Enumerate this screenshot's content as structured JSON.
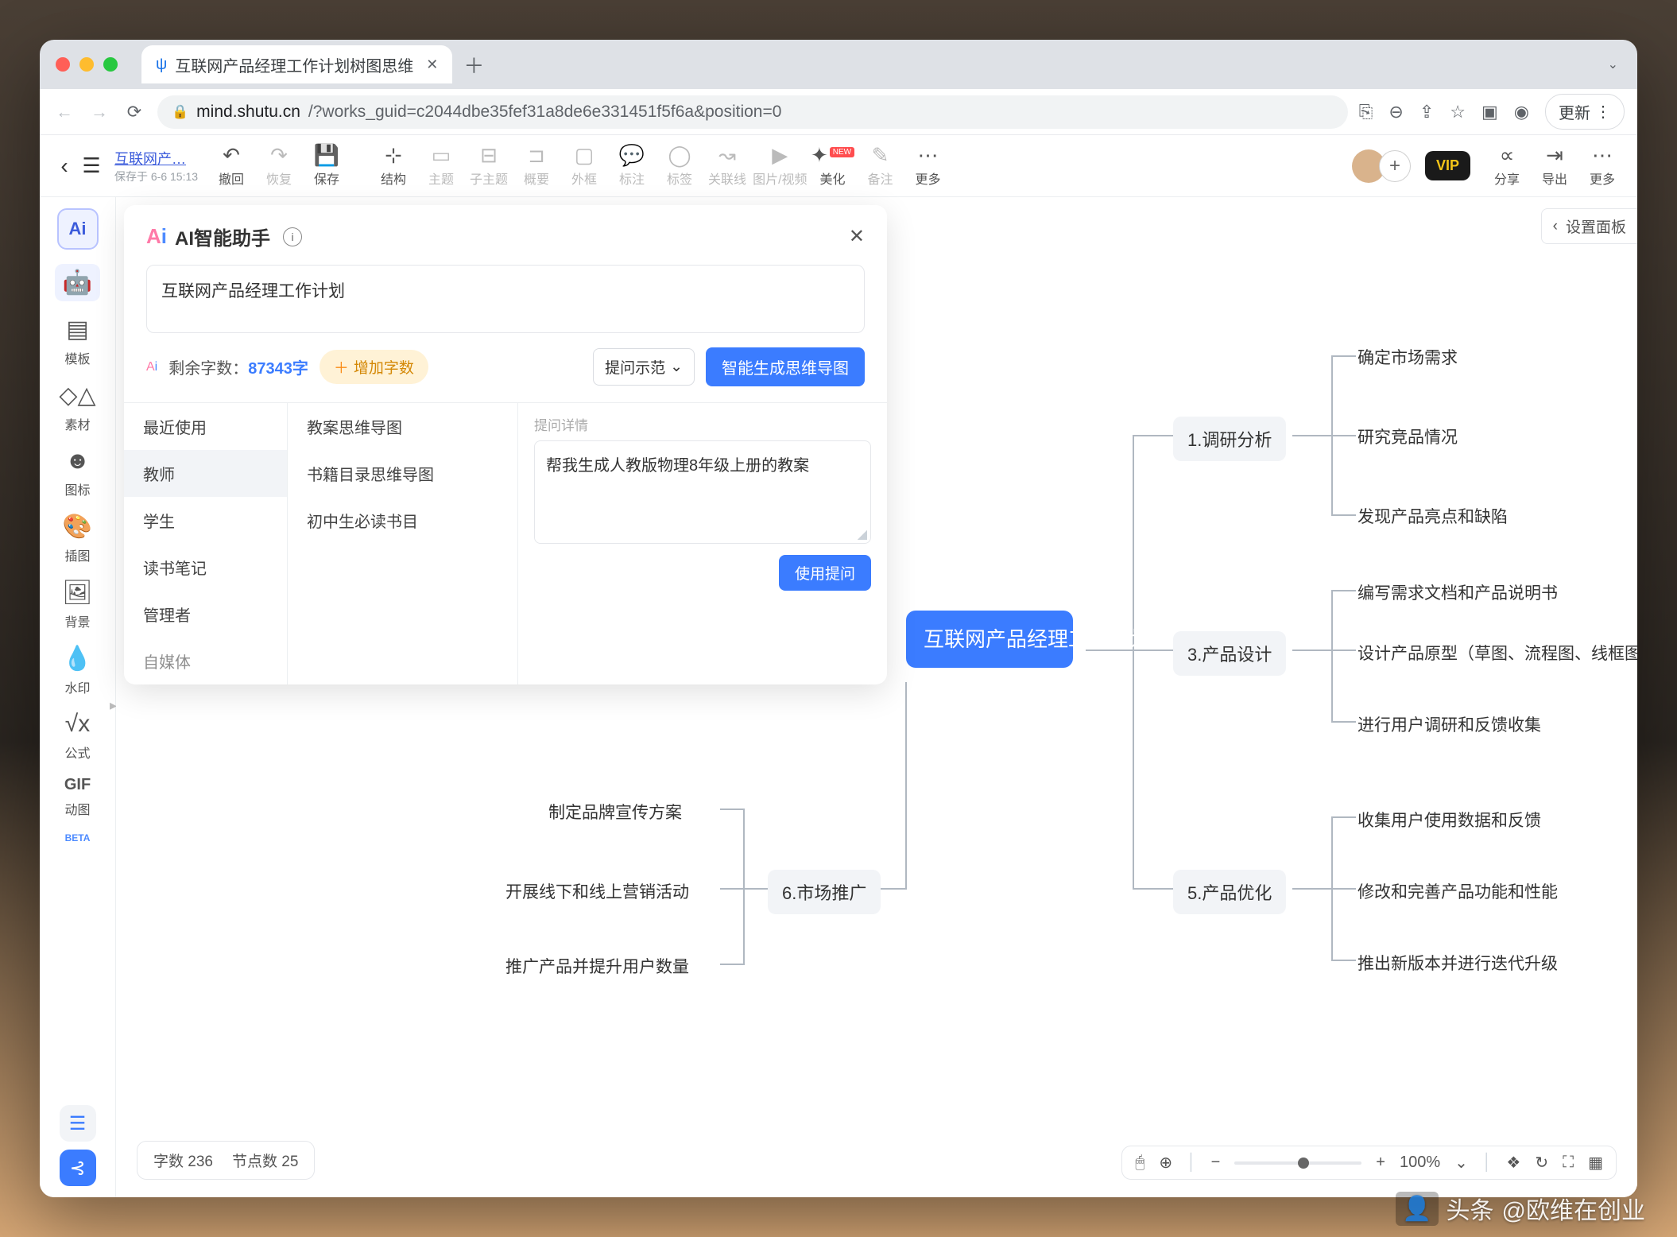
{
  "browser": {
    "tab_title": "互联网产品经理工作计划树图思维",
    "url_domain": "mind.shutu.cn",
    "url_path": "/?works_guid=c2044dbe35fef31a8de6e331451f5f6a&position=0",
    "update_btn": "更新"
  },
  "toolbar": {
    "doc_title": "互联网产…",
    "saved_at": "保存于 6-6 15:13",
    "undo": "撤回",
    "redo": "恢复",
    "save": "保存",
    "structure": "结构",
    "topic": "主题",
    "subtopic": "子主题",
    "summary": "概要",
    "outline": "外框",
    "note": "标注",
    "tag": "标签",
    "relation": "关联线",
    "media": "图片/视频",
    "beautify": "美化",
    "remark": "备注",
    "more": "更多",
    "vip": "VIP",
    "share": "分享",
    "export": "导出",
    "more2": "更多",
    "new_badge": "NEW"
  },
  "sidebar": {
    "ai": "Ai",
    "template": "模板",
    "material": "素材",
    "icon": "图标",
    "illustration": "插图",
    "background": "背景",
    "watermark": "水印",
    "formula": "公式",
    "gif": "GIF",
    "gif_sub": "动图",
    "beta": "BETA"
  },
  "settings_tab": "设置面板",
  "ai_panel": {
    "title": "AI智能助手",
    "input": "互联网产品经理工作计划",
    "quota_label": "剩余字数：",
    "quota_value": "87343字",
    "add_chars": "增加字数",
    "qa_demo": "提问示范",
    "gen_btn": "智能生成思维导图",
    "cats": [
      "最近使用",
      "教师",
      "学生",
      "读书笔记",
      "管理者",
      "自媒体"
    ],
    "subcats": [
      "教案思维导图",
      "书籍目录思维导图",
      "初中生必读书目"
    ],
    "detail_placeholder": "提问详情",
    "detail_text": "帮我生成人教版物理8年级上册的教案",
    "use_btn": "使用提问"
  },
  "mindmap": {
    "center": "互联网产品经理工作计划",
    "n1": "1.调研分析",
    "n1_leaves": [
      "确定市场需求",
      "研究竞品情况",
      "发现产品亮点和缺陷"
    ],
    "n3": "3.产品设计",
    "n3_leaves": [
      "编写需求文档和产品说明书",
      "设计产品原型（草图、流程图、线框图等）",
      "进行用户调研和反馈收集"
    ],
    "n5": "5.产品优化",
    "n5_leaves": [
      "收集用户使用数据和反馈",
      "修改和完善产品功能和性能",
      "推出新版本并进行迭代升级"
    ],
    "n6": "6.市场推广",
    "n6_leaves": [
      "制定品牌宣传方案",
      "开展线下和线上营销活动",
      "推广产品并提升用户数量"
    ]
  },
  "status": {
    "chars": "字数 236",
    "nodes": "节点数 25"
  },
  "zoom": {
    "pct": "100%"
  },
  "watermark": {
    "prefix": "头条",
    "handle": "@欧维在创业"
  }
}
